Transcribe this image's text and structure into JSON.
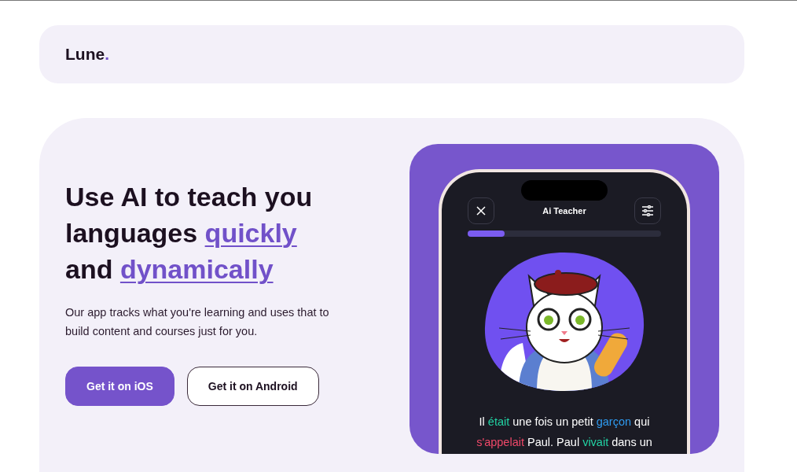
{
  "header": {
    "logo": "Lune",
    "logo_dot": "."
  },
  "hero": {
    "headline": [
      {
        "kind": "text",
        "text": "Use AI to teach you languages "
      },
      {
        "kind": "link",
        "text": "quickly"
      },
      {
        "kind": "text",
        "text": " and "
      },
      {
        "kind": "link",
        "text": "dynamically"
      }
    ],
    "description": "Our app tracks what you're learning and uses that to build content and courses just for you.",
    "buttons": [
      {
        "label": "Get it on iOS",
        "kind": "primary"
      },
      {
        "label": "Get it on Android",
        "kind": "outline"
      }
    ]
  },
  "phone": {
    "title": "Ai Teacher",
    "progress": {
      "level": 0.19
    },
    "story_lines": [
      [
        {
          "text": "Il "
        },
        {
          "text": "était",
          "color": "#22d3a4"
        },
        {
          "text": " une fois un petit "
        },
        {
          "text": "garçon",
          "color": "#2f9bf0"
        },
        {
          "text": " qui"
        }
      ],
      [
        {
          "text": "s'appelait",
          "color": "#f04869"
        },
        {
          "text": " Paul. Paul "
        },
        {
          "text": "vivait",
          "color": "#22d3a4"
        },
        {
          "text": " dans un"
        }
      ]
    ]
  }
}
